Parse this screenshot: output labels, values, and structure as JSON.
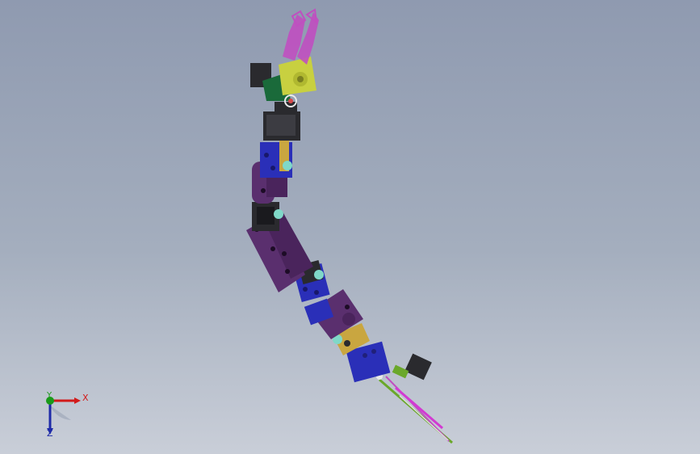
{
  "viewport": {
    "background_top": "#8f9ab0",
    "background_bottom": "#c9ced8"
  },
  "model": {
    "colors": {
      "servo_body": "#2a2a2e",
      "bracket_blue": "#2a2fb8",
      "bracket_purple": "#5a2f6e",
      "bracket_gold": "#c9a640",
      "gripper_pink": "#c04fc0",
      "gripper_yellow": "#c8d040",
      "horn_cyan": "#7fd8c8",
      "base_green": "#6aa82a"
    }
  },
  "triad": {
    "x_label": "X",
    "y_label": "Y",
    "z_label": "Z",
    "x_color": "#d21a1a",
    "y_color": "#1a9a1a",
    "z_color": "#1e2aa8"
  }
}
